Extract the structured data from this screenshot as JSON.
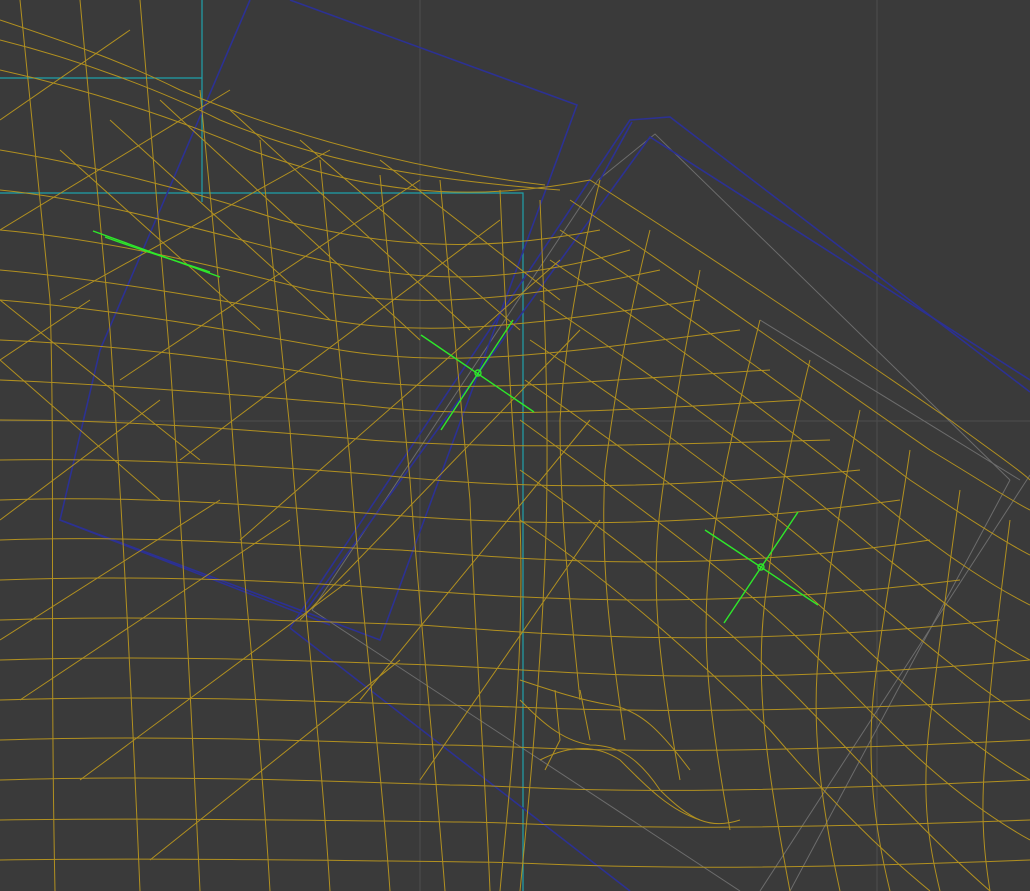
{
  "viewport": {
    "background": "#3a3a3a",
    "colors": {
      "grid": "#4c4c4c",
      "mesh_wire": "#c9a227",
      "bone_outline": "#2b2f8a",
      "selection_cyan": "#1fa7b0",
      "joint_gizmo": "#22e31f",
      "hidden_edges": "#6a6a6a"
    }
  },
  "gizmos": [
    {
      "name": "joint-gizmo-upper-left"
    },
    {
      "name": "joint-gizmo-center"
    },
    {
      "name": "joint-gizmo-right"
    }
  ]
}
